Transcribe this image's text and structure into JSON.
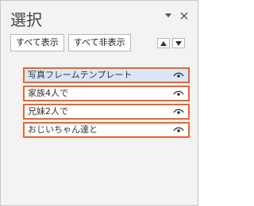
{
  "pane": {
    "title": "選択"
  },
  "toolbar": {
    "show_all_label": "すべて表示",
    "hide_all_label": "すべて非表示"
  },
  "items": [
    {
      "label": "写真フレームテンプレート",
      "selected": true
    },
    {
      "label": "家族4人で",
      "selected": false
    },
    {
      "label": "兄妹2人で",
      "selected": false
    },
    {
      "label": "おじいちゃん達と",
      "selected": false
    }
  ],
  "colors": {
    "accent_outline": "#e8662a",
    "selected_background": "#d9e6f8"
  },
  "icons": {
    "pane_options": "chevron-down-icon",
    "close": "close-icon",
    "bring_forward": "triangle-up-icon",
    "send_backward": "triangle-down-icon",
    "visibility": "eye-icon"
  }
}
